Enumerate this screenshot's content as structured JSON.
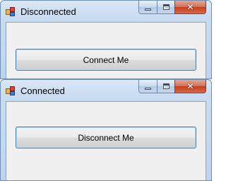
{
  "windows": [
    {
      "title": "Disconnected",
      "button_label": "Connect Me",
      "caption_buttons": {
        "minimize": "minimize-icon",
        "maximize": "maximize-icon",
        "close": "close-icon"
      }
    },
    {
      "title": "Connected",
      "button_label": "Disconnect Me",
      "caption_buttons": {
        "minimize": "minimize-icon",
        "maximize": "maximize-icon",
        "close": "close-icon"
      }
    }
  ],
  "colors": {
    "titlebar": "#c9dcf1",
    "client": "#f0f0f0",
    "close_button": "#c2401f",
    "button_focus_border": "#3c7fb1"
  }
}
